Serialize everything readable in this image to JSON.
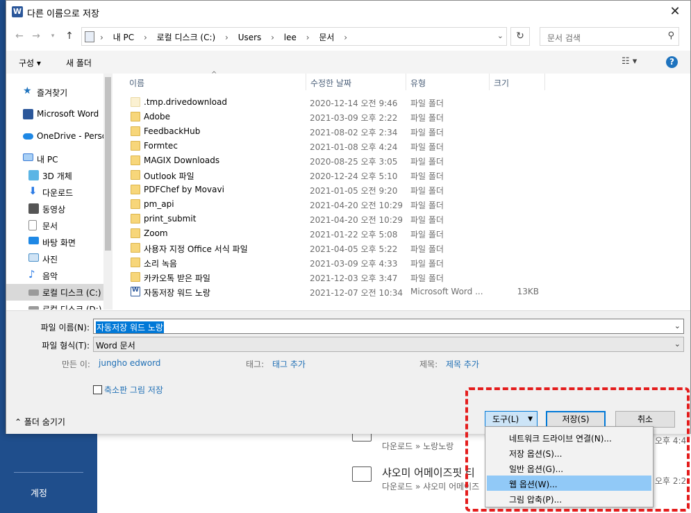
{
  "background": {
    "account_label": "계정",
    "rows": [
      {
        "name": "",
        "path": "다운로드 » 노랑노랑",
        "time": "오후 4:4"
      },
      {
        "name": "샤오미 어메이즈핏 티",
        "path": "다운로드 » 샤오미 어메이즈",
        "time": "오후 2:2"
      },
      {
        "name": "",
        "path": "",
        "time": ""
      }
    ]
  },
  "dialog": {
    "title": "다른 이름으로 저장",
    "app_badge": "W",
    "breadcrumb": [
      "내 PC",
      "로컬 디스크 (C:)",
      "Users",
      "lee",
      "문서"
    ],
    "search_placeholder": "문서 검색",
    "toolbar": {
      "organize": "구성 ▾",
      "new_folder": "새 폴더",
      "help": "?"
    },
    "sidebar": [
      {
        "label": "즐겨찾기",
        "icon": "star-icon",
        "indent": 1,
        "selected": false,
        "color": "#1e73be"
      },
      {
        "label": "Microsoft Word",
        "icon": "word-icon",
        "indent": 1,
        "selected": false,
        "color": "#2b579a"
      },
      {
        "label": "OneDrive - Perso",
        "icon": "cloud-icon",
        "indent": 1,
        "selected": false,
        "color": "#1e88e5"
      },
      {
        "label": "내 PC",
        "icon": "computer-icon",
        "indent": 1,
        "selected": false,
        "color": "#3a7bd5"
      },
      {
        "label": "3D 개체",
        "icon": "cube-icon",
        "indent": 2,
        "selected": false,
        "color": "#5bb5e5"
      },
      {
        "label": "다운로드",
        "icon": "download-icon",
        "indent": 2,
        "selected": false,
        "color": "#2c7be5"
      },
      {
        "label": "동영상",
        "icon": "film-icon",
        "indent": 2,
        "selected": false,
        "color": "#555555"
      },
      {
        "label": "문서",
        "icon": "document-icon",
        "indent": 2,
        "selected": false,
        "color": "#8c8c8c"
      },
      {
        "label": "바탕 화면",
        "icon": "desktop-icon",
        "indent": 2,
        "selected": false,
        "color": "#1e88e5"
      },
      {
        "label": "사진",
        "icon": "picture-icon",
        "indent": 2,
        "selected": false,
        "color": "#4a90c8"
      },
      {
        "label": "음악",
        "icon": "music-icon",
        "indent": 2,
        "selected": false,
        "color": "#2c7be5"
      },
      {
        "label": "로컬 디스크 (C:)",
        "icon": "disk-icon",
        "indent": 2,
        "selected": true,
        "color": "#777777"
      },
      {
        "label": "로컬 디스크 (D:)",
        "icon": "disk-icon",
        "indent": 2,
        "selected": false,
        "color": "#777777"
      }
    ],
    "columns": [
      "이름",
      "수정한 날짜",
      "유형",
      "크기"
    ],
    "files": [
      {
        "name": ".tmp.drivedownload",
        "date": "2020-12-14 오전 9:46",
        "type": "파일 폴더",
        "size": "",
        "icon": "pale-folder-icon"
      },
      {
        "name": "Adobe",
        "date": "2021-03-09 오후 2:22",
        "type": "파일 폴더",
        "size": "",
        "icon": "folder-icon"
      },
      {
        "name": "FeedbackHub",
        "date": "2021-08-02 오후 2:34",
        "type": "파일 폴더",
        "size": "",
        "icon": "folder-icon"
      },
      {
        "name": "Formtec",
        "date": "2021-01-08 오후 4:24",
        "type": "파일 폴더",
        "size": "",
        "icon": "folder-icon"
      },
      {
        "name": "MAGIX Downloads",
        "date": "2020-08-25 오후 3:05",
        "type": "파일 폴더",
        "size": "",
        "icon": "folder-icon"
      },
      {
        "name": "Outlook 파일",
        "date": "2020-12-24 오후 5:10",
        "type": "파일 폴더",
        "size": "",
        "icon": "folder-icon"
      },
      {
        "name": "PDFChef by Movavi",
        "date": "2021-01-05 오전 9:20",
        "type": "파일 폴더",
        "size": "",
        "icon": "folder-icon"
      },
      {
        "name": "pm_api",
        "date": "2021-04-20 오전 10:29",
        "type": "파일 폴더",
        "size": "",
        "icon": "folder-icon"
      },
      {
        "name": "print_submit",
        "date": "2021-04-20 오전 10:29",
        "type": "파일 폴더",
        "size": "",
        "icon": "folder-icon"
      },
      {
        "name": "Zoom",
        "date": "2021-01-22 오후 5:08",
        "type": "파일 폴더",
        "size": "",
        "icon": "folder-icon"
      },
      {
        "name": "사용자 지정 Office 서식 파일",
        "date": "2021-04-05 오후 5:22",
        "type": "파일 폴더",
        "size": "",
        "icon": "folder-icon"
      },
      {
        "name": "소리 녹음",
        "date": "2021-03-09 오후 4:33",
        "type": "파일 폴더",
        "size": "",
        "icon": "folder-icon"
      },
      {
        "name": "카카오톡 받은 파일",
        "date": "2021-12-03 오후 3:47",
        "type": "파일 폴더",
        "size": "",
        "icon": "folder-icon"
      },
      {
        "name": "자동저장 워드 노랑",
        "date": "2021-12-07 오전 10:34",
        "type": "Microsoft Word ...",
        "size": "13KB",
        "icon": "word-doc-icon"
      }
    ],
    "form": {
      "filename_label": "파일 이름(N):",
      "filename_value": "자동저장 워드 노랑",
      "filetype_label": "파일 형식(T):",
      "filetype_value": "Word 문서",
      "author_label": "만든 이:",
      "author_value": "jungho edword",
      "tags_label": "태그:",
      "tags_value": "태그 추가",
      "title_label": "제목:",
      "title_value": "제목 추가",
      "thumbnail_label": "축소판 그림 저장",
      "hide_folders": "폴더 숨기기"
    },
    "buttons": {
      "tools": "도구(L)",
      "save": "저장(S)",
      "cancel": "취소"
    },
    "tools_menu": [
      {
        "label": "네트워크 드라이브 연결(N)...",
        "highlighted": false
      },
      {
        "label": "저장 옵션(S)...",
        "highlighted": false
      },
      {
        "label": "일반 옵션(G)...",
        "highlighted": false
      },
      {
        "label": "웹 옵션(W)...",
        "highlighted": true
      },
      {
        "label": "그림 압축(P)...",
        "highlighted": false
      }
    ]
  },
  "annotation_color": "#e41d1d"
}
